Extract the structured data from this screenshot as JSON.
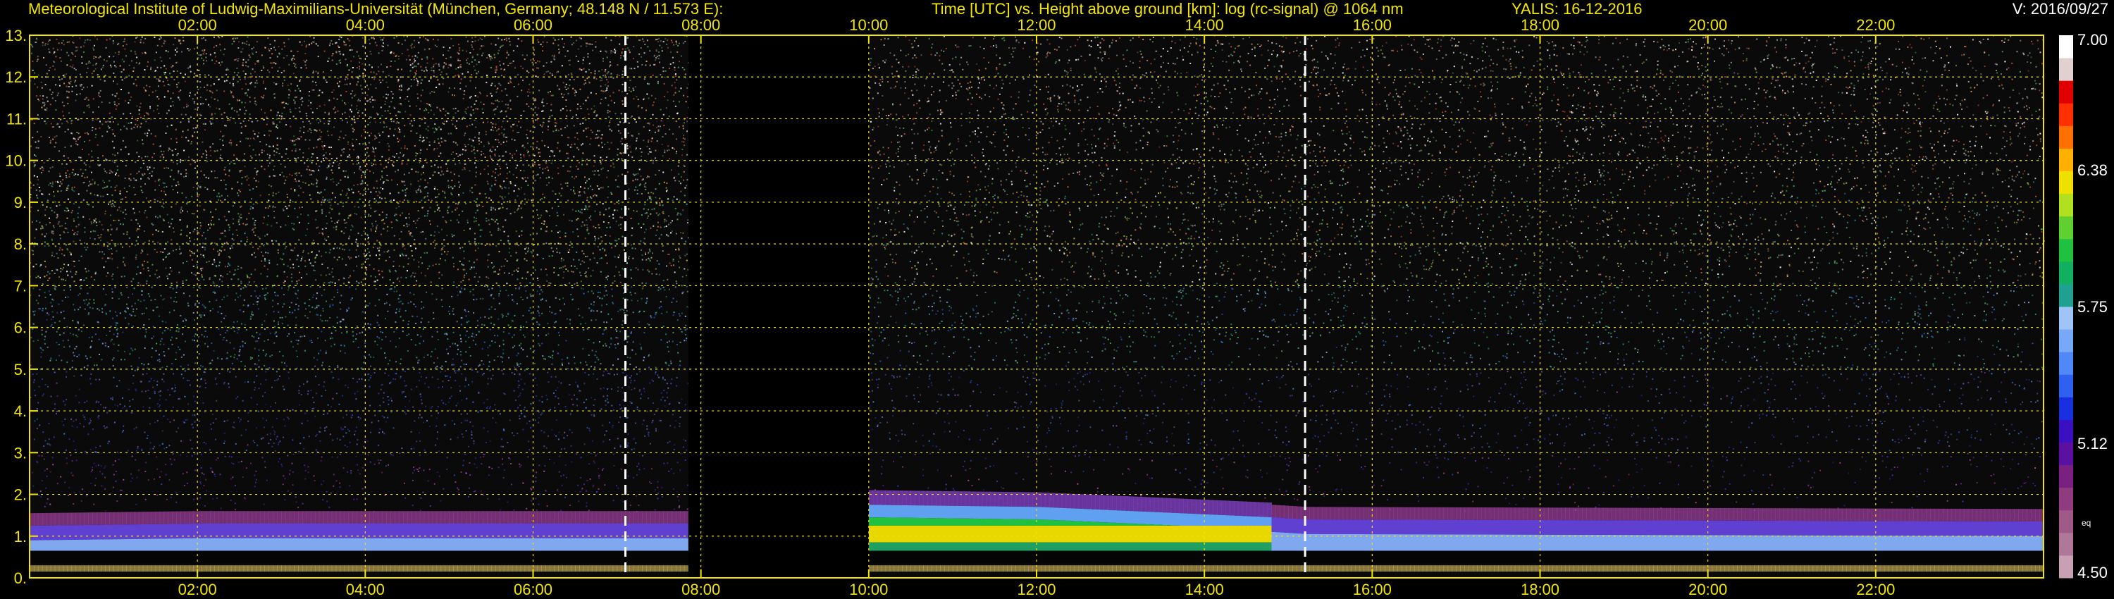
{
  "header": {
    "institute": "Meteorological Institute of Ludwig-Maximilians-Universität (München, Germany; 48.148 N / 11.573 E):",
    "axes_title": "Time [UTC] vs. Height above ground [km]: log (rc-signal) @ 1064 nm",
    "instrument_date": "YALIS: 16-12-2016",
    "version": "V: 2016/09/27"
  },
  "chart_data": {
    "type": "heatmap",
    "title": "Time [UTC] vs. Height above ground [km]: log (rc-signal) @ 1064 nm",
    "x_axis": {
      "unit": "UTC hours",
      "range": [
        0,
        24
      ],
      "top_ticks": [
        {
          "value": 2,
          "label": "02:00"
        },
        {
          "value": 4,
          "label": "04:00"
        },
        {
          "value": 6,
          "label": "06:00"
        },
        {
          "value": 8,
          "label": "08:00"
        },
        {
          "value": 10,
          "label": "10:00"
        },
        {
          "value": 12,
          "label": "12:00"
        },
        {
          "value": 14,
          "label": "14:00"
        },
        {
          "value": 16,
          "label": "16:00"
        },
        {
          "value": 18,
          "label": "18:00"
        },
        {
          "value": 20,
          "label": "20:00"
        },
        {
          "value": 22,
          "label": "22:00"
        }
      ],
      "bottom_ticks": [
        {
          "value": 2,
          "label": "02:00"
        },
        {
          "value": 4,
          "label": "04:00"
        },
        {
          "value": 6,
          "label": "06:00"
        },
        {
          "value": 8,
          "label": "08:00"
        },
        {
          "value": 10,
          "label": "10:00"
        },
        {
          "value": 12,
          "label": "12:00"
        },
        {
          "value": 14,
          "label": "14:00"
        },
        {
          "value": 16,
          "label": "16:00"
        },
        {
          "value": 18,
          "label": "18:00"
        },
        {
          "value": 20,
          "label": "20:00"
        },
        {
          "value": 22,
          "label": "22:00"
        }
      ]
    },
    "y_axis": {
      "unit": "km",
      "range": [
        0,
        13
      ],
      "ticks": [
        {
          "value": 0,
          "label": "0."
        },
        {
          "value": 1,
          "label": "1."
        },
        {
          "value": 2,
          "label": "2."
        },
        {
          "value": 3,
          "label": "3."
        },
        {
          "value": 4,
          "label": "4."
        },
        {
          "value": 5,
          "label": "5."
        },
        {
          "value": 6,
          "label": "6."
        },
        {
          "value": 7,
          "label": "7."
        },
        {
          "value": 8,
          "label": "8."
        },
        {
          "value": 9,
          "label": "9."
        },
        {
          "value": 10,
          "label": "10."
        },
        {
          "value": 11,
          "label": "11."
        },
        {
          "value": 12,
          "label": "12."
        },
        {
          "value": 13,
          "label": "13."
        }
      ]
    },
    "grid": true,
    "no_data_period": [
      7.85,
      10.0
    ],
    "markers": [
      7.1,
      15.2
    ],
    "boundary_layer": [
      {
        "t": 0.0,
        "top": 1.25,
        "strong": false
      },
      {
        "t": 2.0,
        "top": 1.3,
        "strong": false
      },
      {
        "t": 7.8,
        "top": 1.3,
        "strong": false
      },
      {
        "t": 10.0,
        "top": 1.75,
        "strong": true
      },
      {
        "t": 12.0,
        "top": 1.7,
        "strong": true
      },
      {
        "t": 14.8,
        "top": 1.45,
        "strong": true
      },
      {
        "t": 15.2,
        "top": 1.4,
        "strong": false
      },
      {
        "t": 24.0,
        "top": 1.35,
        "strong": false
      }
    ],
    "colorbar": {
      "range": [
        4.5,
        7.0
      ],
      "tick_labels": [
        "7.00",
        "6.38",
        "5.75",
        "5.12",
        "4.50"
      ],
      "tick_values": [
        7.0,
        6.38,
        5.75,
        5.12,
        4.5
      ],
      "small_label": "eq",
      "colors": [
        "#c8a0b4",
        "#b07898",
        "#a05a88",
        "#903a80",
        "#7a2080",
        "#5a10a0",
        "#3a10c0",
        "#1830e0",
        "#3060f0",
        "#5088f8",
        "#78a8f8",
        "#a0c4f8",
        "#20a090",
        "#10b060",
        "#20c040",
        "#60d030",
        "#b0e020",
        "#f0e000",
        "#ffb000",
        "#ff7000",
        "#ff3000",
        "#e00000",
        "#e0d0d0",
        "#ffffff"
      ]
    }
  }
}
